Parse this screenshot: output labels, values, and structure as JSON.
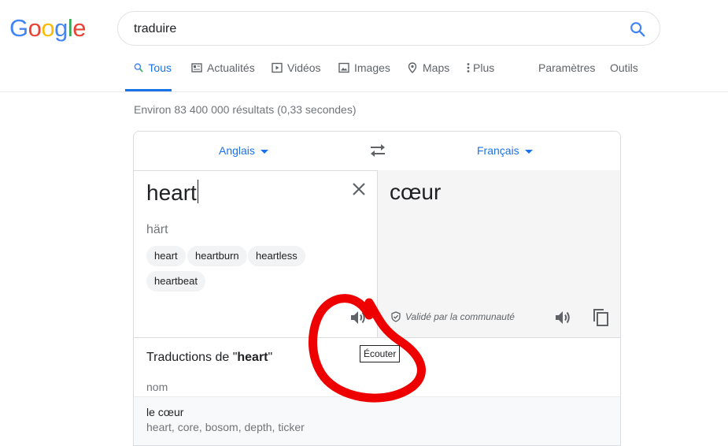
{
  "logo": {
    "letters": [
      "G",
      "o",
      "o",
      "g",
      "l",
      "e"
    ],
    "colors": [
      "#4285F4",
      "#EA4335",
      "#FBBC05",
      "#4285F4",
      "#34A853",
      "#EA4335"
    ]
  },
  "search": {
    "query": "traduire",
    "icon": "search-icon"
  },
  "tabs": [
    {
      "label": "Tous",
      "icon": "search-icon",
      "active": true
    },
    {
      "label": "Actualités",
      "icon": "news-icon"
    },
    {
      "label": "Vidéos",
      "icon": "video-icon"
    },
    {
      "label": "Images",
      "icon": "image-icon"
    },
    {
      "label": "Maps",
      "icon": "map-pin-icon"
    },
    {
      "label": "Plus",
      "icon": "more-vertical-icon"
    },
    {
      "label": "Paramètres"
    },
    {
      "label": "Outils"
    }
  ],
  "stats": "Environ 83 400 000 résultats (0,33 secondes)",
  "translate": {
    "source_lang": "Anglais",
    "target_lang": "Français",
    "source_text": "heart",
    "phonetic": "härt",
    "suggestions": [
      "heart",
      "heartburn",
      "heartless",
      "heartbeat"
    ],
    "target_text": "cœur",
    "validated": "Validé par la communauté",
    "tooltip": "Écouter"
  },
  "dictionary": {
    "title_prefix": "Traductions de \"",
    "title_word": "heart",
    "title_suffix": "\"",
    "part_of_speech": "nom",
    "entries": [
      {
        "main": "le cœur",
        "synonyms": "heart, core, bosom, depth, ticker"
      }
    ]
  },
  "accent_color": "#1a73e8",
  "annotation_color": "#ee0000"
}
